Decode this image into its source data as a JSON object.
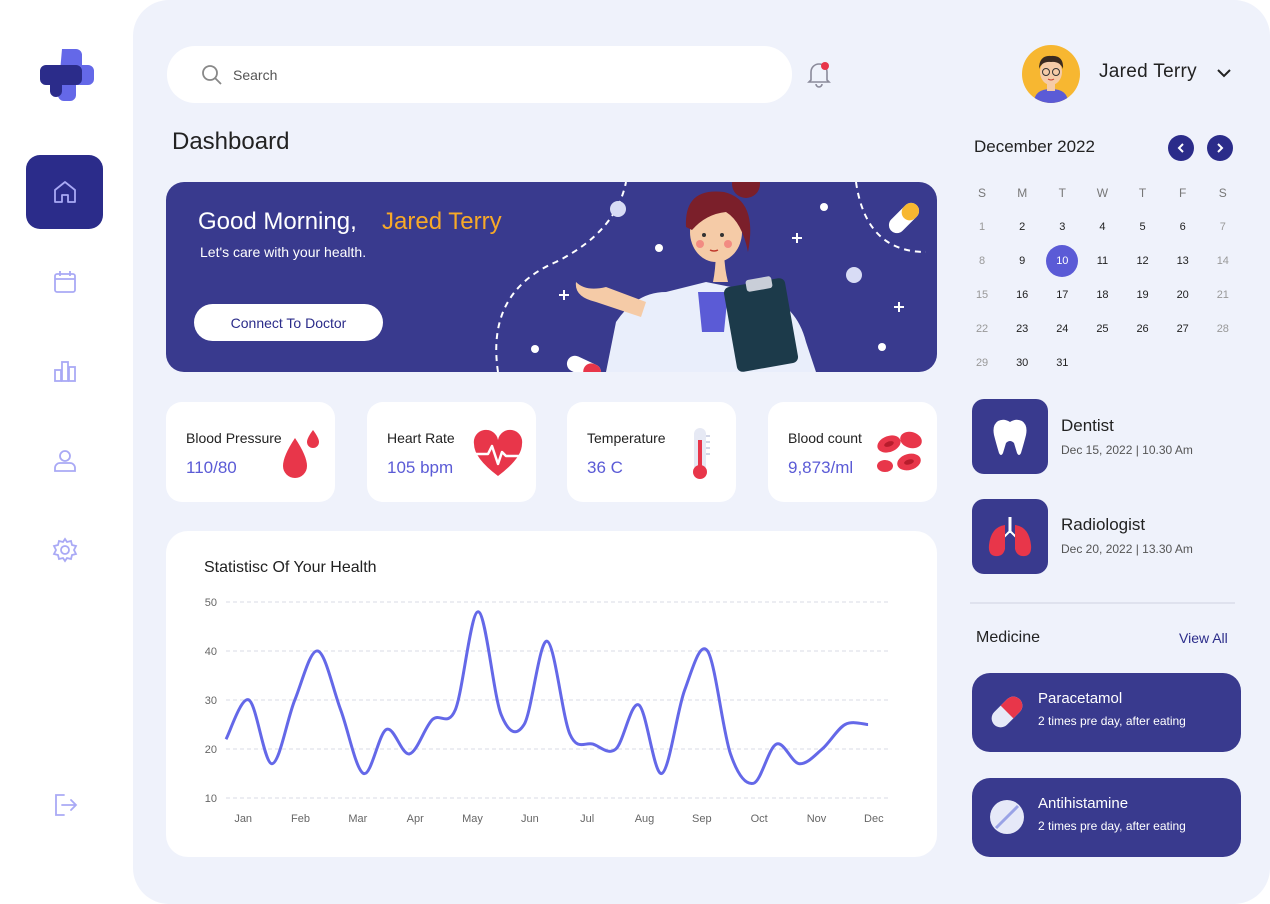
{
  "search": {
    "placeholder": "Search"
  },
  "user": {
    "name": "Jared Terry"
  },
  "page": {
    "title": "Dashboard"
  },
  "banner": {
    "greeting": "Good Morning,",
    "name": "Jared Terry",
    "subtitle": "Let's care with your health.",
    "button_label": "Connect To Doctor"
  },
  "stats": [
    {
      "label": "Blood Pressure",
      "value": "110/80",
      "icon": "blood-drop-icon"
    },
    {
      "label": "Heart Rate",
      "value": "105 bpm",
      "icon": "heart-rate-icon"
    },
    {
      "label": "Temperature",
      "value": "36 C",
      "icon": "thermometer-icon"
    },
    {
      "label": "Blood count",
      "value": "9,873/ml",
      "icon": "blood-cells-icon"
    }
  ],
  "chart_data": {
    "type": "line",
    "title": "Statistisc Of Your Health",
    "categories": [
      "Jan",
      "Feb",
      "Mar",
      "Apr",
      "May",
      "Jun",
      "Jul",
      "Aug",
      "Sep",
      "Oct",
      "Nov",
      "Dec"
    ],
    "x": [
      0,
      0.4,
      0.8,
      1.2,
      1.6,
      2.0,
      2.4,
      2.8,
      3.2,
      3.6,
      4.0,
      4.4,
      4.8,
      5.2,
      5.6,
      6.0,
      6.4,
      6.8,
      7.2,
      7.6,
      8.0,
      8.4,
      8.8,
      9.2,
      9.6,
      10.0,
      10.4,
      10.8,
      11.2
    ],
    "values": [
      22,
      30,
      17,
      30,
      40,
      28,
      15,
      24,
      19,
      26,
      28,
      48,
      27,
      25,
      42,
      23,
      21,
      20,
      29,
      15,
      32,
      40,
      19,
      13,
      21,
      17,
      20,
      25,
      25
    ],
    "ylim": [
      10,
      50
    ],
    "yticks": [
      10,
      20,
      30,
      40,
      50
    ],
    "grid": true,
    "color": "#6468e8"
  },
  "calendar": {
    "title": "December 2022",
    "weekdays": [
      "S",
      "M",
      "T",
      "W",
      "T",
      "F",
      "S"
    ],
    "weeks": [
      [
        "1",
        "2",
        "3",
        "4",
        "5",
        "6",
        "7"
      ],
      [
        "8",
        "9",
        "10",
        "11",
        "12",
        "13",
        "14"
      ],
      [
        "15",
        "16",
        "17",
        "18",
        "19",
        "20",
        "21"
      ],
      [
        "22",
        "23",
        "24",
        "25",
        "26",
        "27",
        "28"
      ],
      [
        "29",
        "30",
        "31",
        "",
        "",
        "",
        ""
      ]
    ],
    "selected": "10"
  },
  "appointments": [
    {
      "title": "Dentist",
      "date": "Dec 15, 2022 | 10.30 Am",
      "icon": "tooth-icon"
    },
    {
      "title": "Radiologist",
      "date": "Dec 20, 2022 | 13.30 Am",
      "icon": "lungs-icon"
    }
  ],
  "medicine": {
    "title": "Medicine",
    "link": "View All",
    "items": [
      {
        "name": "Paracetamol",
        "desc": "2 times pre day, after eating",
        "icon": "capsule-icon"
      },
      {
        "name": "Antihistamine",
        "desc": "2 times pre day, after eating",
        "icon": "tablet-icon"
      }
    ]
  },
  "colors": {
    "primary": "#2b2c8a",
    "accent": "#5b5bd6",
    "orange": "#f7a928",
    "red": "#e8364a",
    "panel_bg": "#eff2fb"
  }
}
